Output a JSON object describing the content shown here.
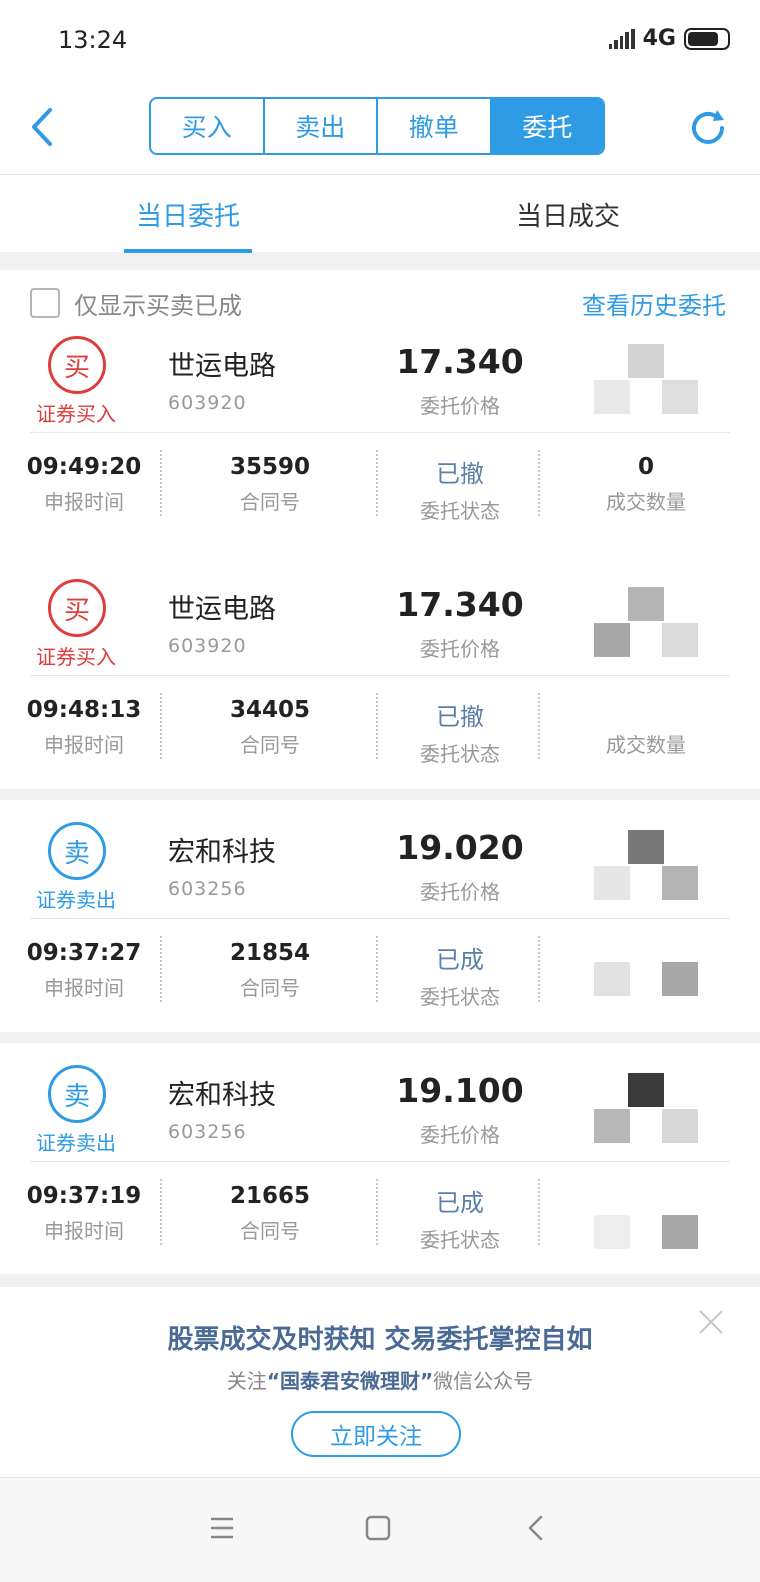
{
  "status_bar": {
    "time": "13:24",
    "network": "4G"
  },
  "header": {
    "segments": [
      {
        "label": "买入",
        "active": false
      },
      {
        "label": "卖出",
        "active": false
      },
      {
        "label": "撤单",
        "active": false
      },
      {
        "label": "委托",
        "active": true
      }
    ]
  },
  "tabs": [
    {
      "label": "当日委托",
      "active": true
    },
    {
      "label": "当日成交",
      "active": false
    }
  ],
  "filter": {
    "label": "仅显示买卖已成",
    "checked": false,
    "history_link": "查看历史委托"
  },
  "orders": [
    {
      "badge": "买",
      "direction": "证券买入",
      "side": "buy",
      "name": "世运电路",
      "code": "603920",
      "price": "17.340",
      "price_label": "委托价格",
      "time": "09:49:20",
      "time_label": "申报时间",
      "contract": "35590",
      "contract_label": "合同号",
      "status": "已撤",
      "status_label": "委托状态",
      "qty": "0",
      "qty_label": "成交数量"
    },
    {
      "badge": "买",
      "direction": "证券买入",
      "side": "buy",
      "name": "世运电路",
      "code": "603920",
      "price": "17.340",
      "price_label": "委托价格",
      "time": "09:48:13",
      "time_label": "申报时间",
      "contract": "34405",
      "contract_label": "合同号",
      "status": "已撤",
      "status_label": "委托状态",
      "qty": "",
      "qty_label": "成交数量"
    },
    {
      "badge": "卖",
      "direction": "证券卖出",
      "side": "sell",
      "name": "宏和科技",
      "code": "603256",
      "price": "19.020",
      "price_label": "委托价格",
      "time": "09:37:27",
      "time_label": "申报时间",
      "contract": "21854",
      "contract_label": "合同号",
      "status": "已成",
      "status_label": "委托状态",
      "qty": "",
      "qty_label": ""
    },
    {
      "badge": "卖",
      "direction": "证券卖出",
      "side": "sell",
      "name": "宏和科技",
      "code": "603256",
      "price": "19.100",
      "price_label": "委托价格",
      "time": "09:37:19",
      "time_label": "申报时间",
      "contract": "21665",
      "contract_label": "合同号",
      "status": "已成",
      "status_label": "委托状态",
      "qty": "",
      "qty_label": ""
    }
  ],
  "promo": {
    "headline": "股票成交及时获知   交易委托掌控自如",
    "sub_prefix": "关注",
    "sub_highlight": "“国泰君安微理财”",
    "sub_suffix": "微信公众号",
    "button": "立即关注"
  },
  "colors": {
    "accent": "#2f9be4",
    "buy": "#e03c3c",
    "promo_text": "#4a6a96"
  },
  "icons": {
    "back": "chevron-left-icon",
    "refresh": "refresh-icon",
    "close": "close-icon",
    "nav_menu": "menu-icon",
    "nav_home": "square-icon",
    "nav_back": "back-icon"
  }
}
